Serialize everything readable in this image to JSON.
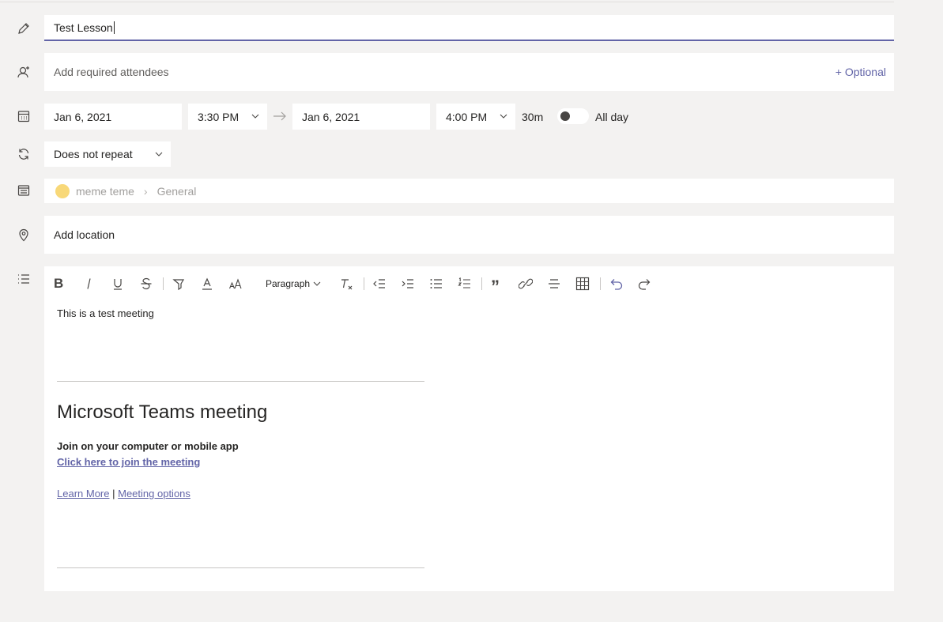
{
  "title_field": {
    "value": "Test Lesson"
  },
  "attendees": {
    "placeholder": "Add required attendees",
    "optional_label": "+ Optional"
  },
  "schedule": {
    "start_date": "Jan 6, 2021",
    "start_time": "3:30 PM",
    "end_date": "Jan 6, 2021",
    "end_time": "4:00 PM",
    "duration": "30m",
    "all_day_label": "All day",
    "all_day_on": false
  },
  "repeat": {
    "value": "Does not repeat"
  },
  "channel": {
    "team": "meme teme",
    "channel": "General"
  },
  "location": {
    "placeholder": "Add location"
  },
  "editor": {
    "toolbar": {
      "paragraph_label": "Paragraph"
    },
    "body_text": "This is a test meeting",
    "meeting_title": "Microsoft Teams meeting",
    "join_heading": "Join on your computer or mobile app",
    "join_link": "Click here to join the meeting",
    "learn_more": "Learn More",
    "divider": "|",
    "meeting_options": "Meeting options"
  },
  "colors": {
    "accent": "#6264a7",
    "background": "#f3f2f1"
  }
}
